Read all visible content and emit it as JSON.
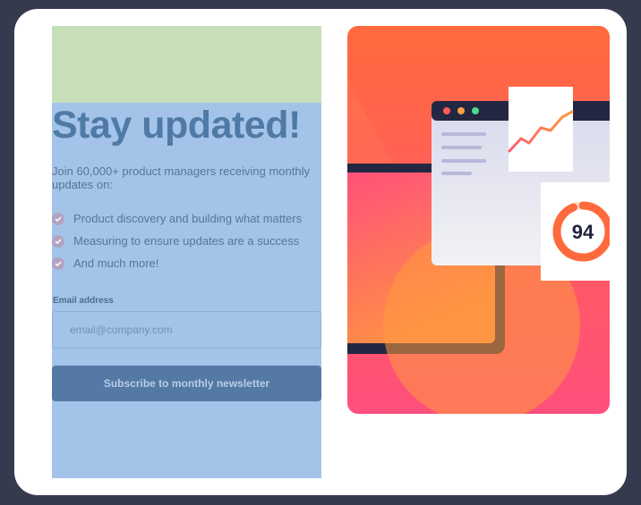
{
  "newsletter": {
    "title": "Stay updated!",
    "intro": "Join 60,000+ product managers receiving monthly updates on:",
    "bullets": [
      "Product discovery and building what matters",
      "Measuring to ensure updates are a success",
      "And much more!"
    ],
    "email_label": "Email address",
    "email_placeholder": "email@company.com",
    "email_value": "",
    "subscribe_label": "Subscribe to monthly newsletter"
  },
  "illustration": {
    "score": "94",
    "score_fraction": 0.94,
    "window_dot_colors": [
      "#ff5a5a",
      "#ff9f4a",
      "#4ad991"
    ],
    "colors": {
      "gradient_top": "#ff6a3d",
      "gradient_bottom": "#ff4f7c",
      "dark_frame": "#242742",
      "chart_line": "#ff7a4a"
    }
  },
  "colors": {
    "page_bg": "#363a4f",
    "card_bg": "#ffffff",
    "title": "#4f7aa6",
    "button_bg": "#5479a5"
  }
}
